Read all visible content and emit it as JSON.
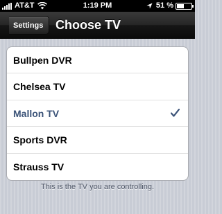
{
  "status_bar": {
    "carrier": "AT&T",
    "time": "1:19 PM",
    "battery": "51 %",
    "battery_level": 0.51,
    "signal_icon": "signal-bars-icon",
    "wifi_icon": "wifi-icon",
    "location_icon": "location-arrow-icon"
  },
  "nav": {
    "back_label": "Settings",
    "title": "Choose TV"
  },
  "tv_list": {
    "items": [
      {
        "name": "Bullpen DVR",
        "selected": false
      },
      {
        "name": "Chelsea TV",
        "selected": false
      },
      {
        "name": "Mallon TV",
        "selected": true
      },
      {
        "name": "Sports DVR",
        "selected": false
      },
      {
        "name": "Strauss TV",
        "selected": false
      }
    ],
    "check_icon": "checkmark-icon",
    "selected_color": "#3b5378"
  },
  "footer": {
    "note": "This is the TV you are controlling."
  }
}
